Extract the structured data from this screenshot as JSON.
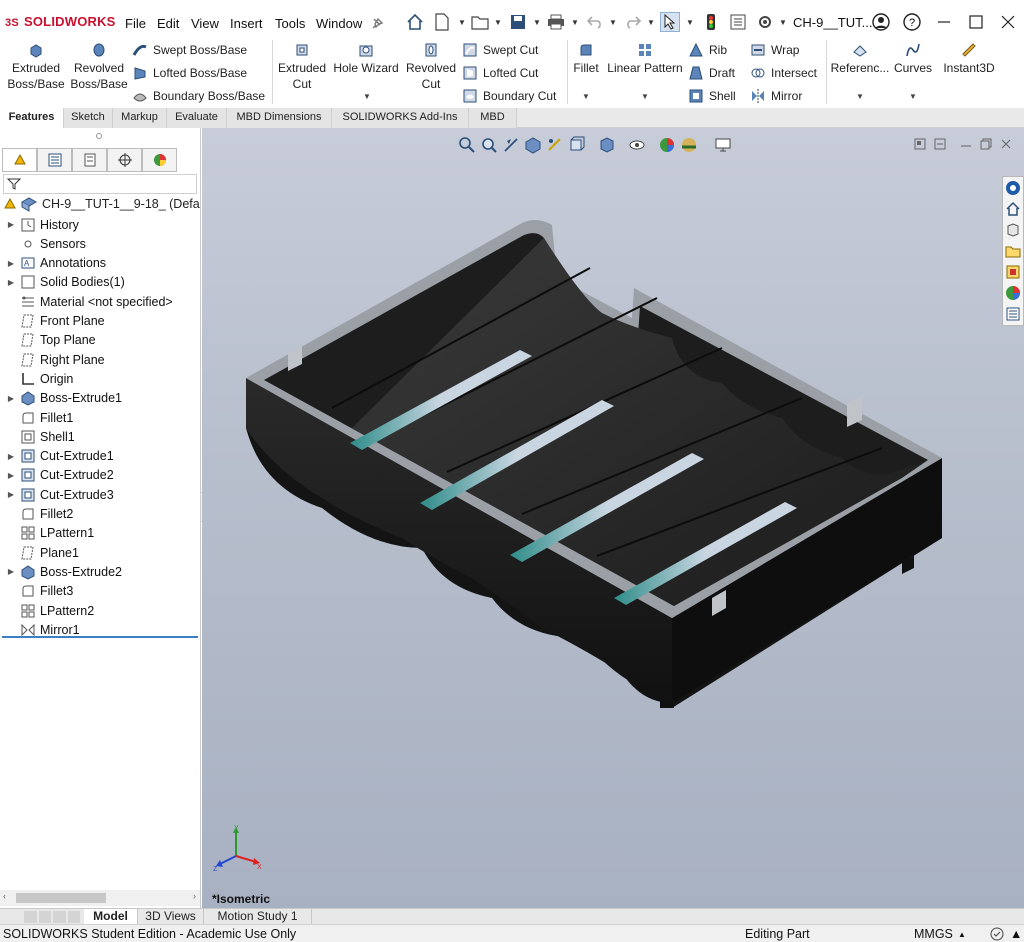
{
  "app": {
    "brand": "SOLIDWORKS",
    "doc_title": "CH-9__TUT..."
  },
  "menu": [
    "File",
    "Edit",
    "View",
    "Insert",
    "Tools",
    "Window"
  ],
  "ribbon": {
    "extruded_boss": "Extruded\nBoss/Base",
    "revolved_boss": "Revolved\nBoss/Base",
    "swept_boss": "Swept Boss/Base",
    "lofted_boss": "Lofted Boss/Base",
    "boundary_boss": "Boundary Boss/Base",
    "extruded_cut": "Extruded\nCut",
    "hole_wizard": "Hole Wizard",
    "revolved_cut": "Revolved\nCut",
    "swept_cut": "Swept Cut",
    "lofted_cut": "Lofted Cut",
    "boundary_cut": "Boundary Cut",
    "fillet": "Fillet",
    "linear_pattern": "Linear Pattern",
    "rib": "Rib",
    "draft": "Draft",
    "shell": "Shell",
    "wrap": "Wrap",
    "intersect": "Intersect",
    "mirror": "Mirror",
    "reference": "Referenc...",
    "curves": "Curves",
    "instant3d": "Instant3D"
  },
  "tabs": [
    "Features",
    "Sketch",
    "Markup",
    "Evaluate",
    "MBD Dimensions",
    "SOLIDWORKS Add-Ins",
    "MBD"
  ],
  "tree": {
    "root": "CH-9__TUT-1__9-18_ (Defa",
    "items": [
      {
        "label": "History",
        "icon": "history-icon",
        "expand": true
      },
      {
        "label": "Sensors",
        "icon": "sensor-icon",
        "expand": false
      },
      {
        "label": "Annotations",
        "icon": "annotation-icon",
        "expand": true
      },
      {
        "label": "Solid Bodies(1)",
        "icon": "solid-bodies-icon",
        "expand": true
      },
      {
        "label": "Material <not specified>",
        "icon": "material-icon",
        "expand": false
      },
      {
        "label": "Front Plane",
        "icon": "plane-icon",
        "expand": false
      },
      {
        "label": "Top Plane",
        "icon": "plane-icon",
        "expand": false
      },
      {
        "label": "Right Plane",
        "icon": "plane-icon",
        "expand": false
      },
      {
        "label": "Origin",
        "icon": "origin-icon",
        "expand": false
      },
      {
        "label": "Boss-Extrude1",
        "icon": "extrude-icon",
        "expand": true
      },
      {
        "label": "Fillet1",
        "icon": "fillet-icon",
        "expand": false
      },
      {
        "label": "Shell1",
        "icon": "shell-icon",
        "expand": false
      },
      {
        "label": "Cut-Extrude1",
        "icon": "cut-icon",
        "expand": true
      },
      {
        "label": "Cut-Extrude2",
        "icon": "cut-icon",
        "expand": true
      },
      {
        "label": "Cut-Extrude3",
        "icon": "cut-icon",
        "expand": true
      },
      {
        "label": "Fillet2",
        "icon": "fillet-icon",
        "expand": false
      },
      {
        "label": "LPattern1",
        "icon": "pattern-icon",
        "expand": false
      },
      {
        "label": "Plane1",
        "icon": "plane-icon",
        "expand": false
      },
      {
        "label": "Boss-Extrude2",
        "icon": "extrude-icon",
        "expand": true
      },
      {
        "label": "Fillet3",
        "icon": "fillet-icon",
        "expand": false
      },
      {
        "label": "LPattern2",
        "icon": "pattern-icon",
        "expand": false
      },
      {
        "label": "Mirror1",
        "icon": "mirror-icon",
        "expand": false
      }
    ]
  },
  "viewport": {
    "view_label": "*Isometric"
  },
  "bottom_tabs": [
    "Model",
    "3D Views",
    "Motion Study 1"
  ],
  "status": {
    "edition": "SOLIDWORKS Student Edition - Academic Use Only",
    "mode": "Editing Part",
    "units": "MMGS"
  },
  "colors": {
    "accent": "#3b7fc4",
    "brand": "#c8102e",
    "part": "#232323",
    "slot_highlight": "#1e7a78"
  }
}
